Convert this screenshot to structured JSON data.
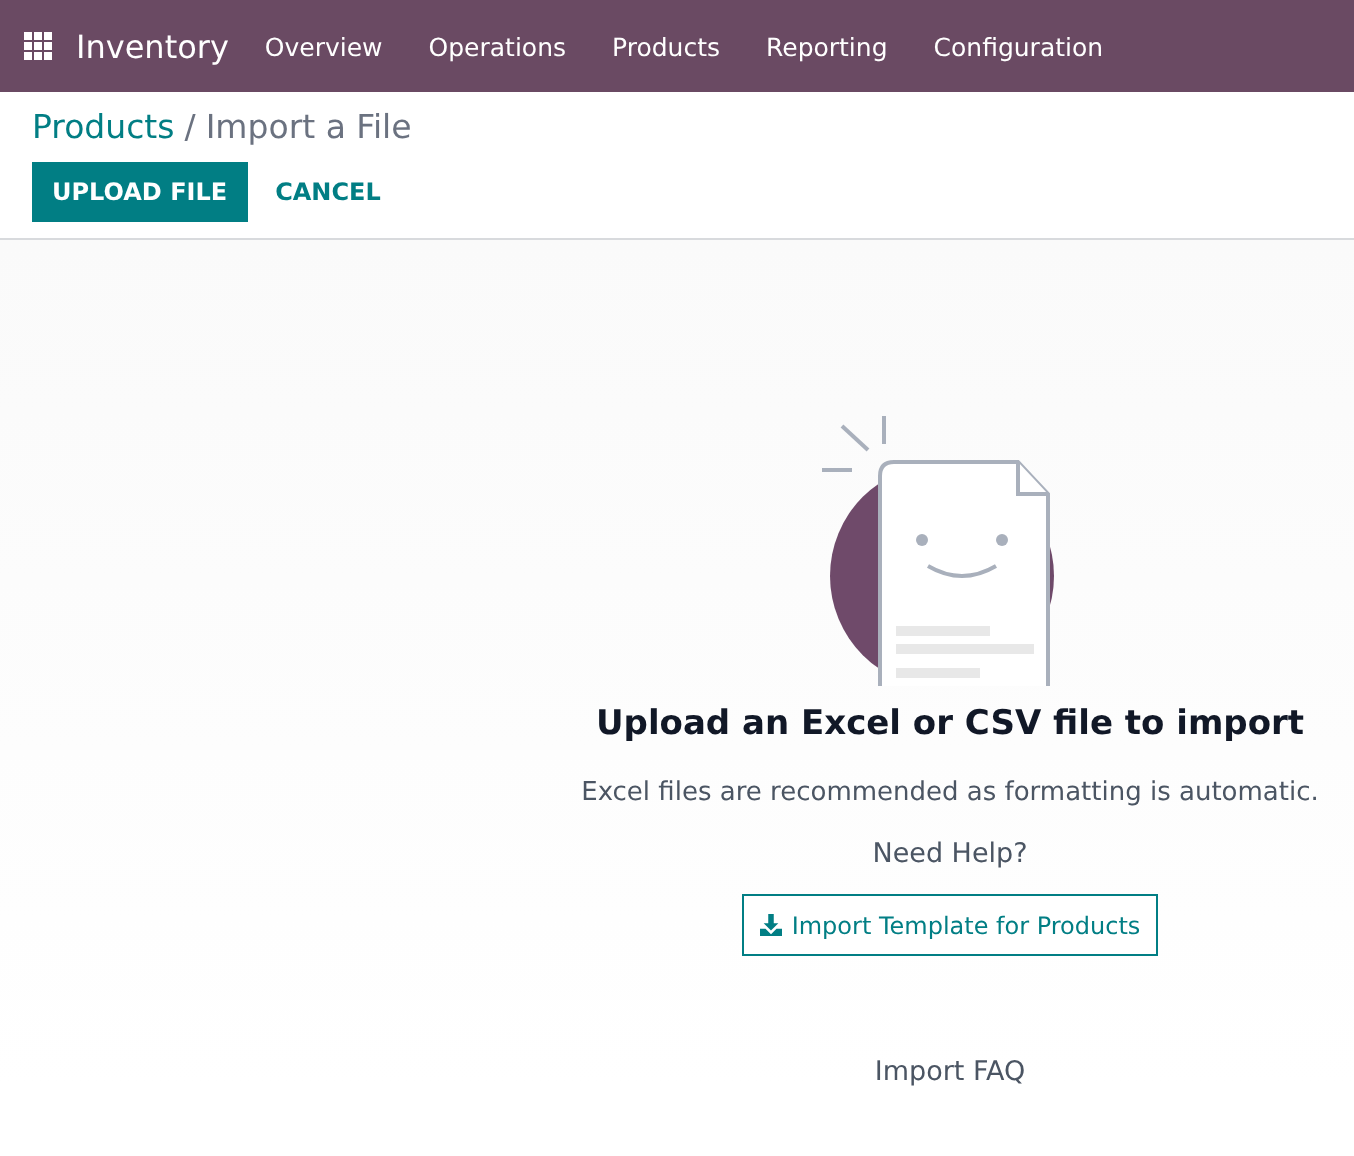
{
  "navbar": {
    "app_name": "Inventory",
    "menu": [
      "Overview",
      "Operations",
      "Products",
      "Reporting",
      "Configuration"
    ]
  },
  "breadcrumb": {
    "parent": "Products",
    "separator": "/",
    "current": "Import a File"
  },
  "actions": {
    "primary": "UPLOAD FILE",
    "secondary": "CANCEL"
  },
  "empty_state": {
    "title": "Upload an Excel or CSV file to import",
    "description": "Excel files are recommended as formatting is automatic.",
    "help_label": "Need Help?",
    "template_button": "Import Template for Products",
    "faq_link": "Import FAQ"
  }
}
